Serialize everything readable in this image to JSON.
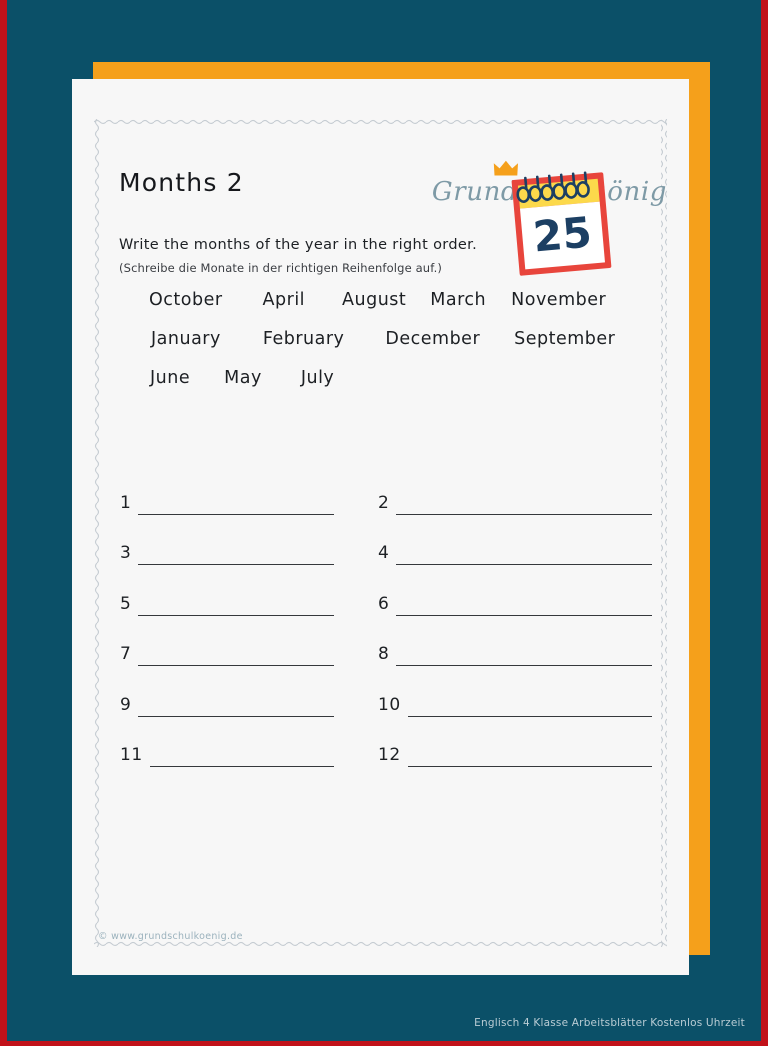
{
  "page": {
    "background_color": "#0b5068",
    "border_color": "#c1121a",
    "accent_color": "#f5a01b",
    "paper_color": "#f7f7f7"
  },
  "logo": {
    "text": "Grundschulkönig",
    "crown_icon": "crown-icon",
    "color": "#7e9aa6",
    "crown_color": "#f5a01b"
  },
  "worksheet": {
    "title": "Months 2",
    "instruction_en": "Write the months of the year in the right order.",
    "instruction_de": "(Schreibe die Monate in der richtigen Reihenfolge auf.)",
    "footer": "© www.grundschulkoenig.de"
  },
  "calendar_icon": {
    "name": "calendar-icon",
    "day_number": "25",
    "frame_color": "#e8453c",
    "band_color": "#fcd94b",
    "number_color": "#1c3f63",
    "ring_color": "#1c3f63"
  },
  "word_bank": {
    "rows": [
      [
        "October",
        "April",
        "August",
        "March",
        "November"
      ],
      [
        "January",
        "February",
        "December",
        "September"
      ],
      [
        "June",
        "May",
        "July"
      ]
    ]
  },
  "answer_lines": {
    "rows": [
      [
        "1",
        "2"
      ],
      [
        "3",
        "4"
      ],
      [
        "5",
        "6"
      ],
      [
        "7",
        "8"
      ],
      [
        "9",
        "10"
      ],
      [
        "11",
        "12"
      ]
    ]
  },
  "bottom_caption": "Englisch 4 Klasse Arbeitsblätter Kostenlos Uhrzeit"
}
